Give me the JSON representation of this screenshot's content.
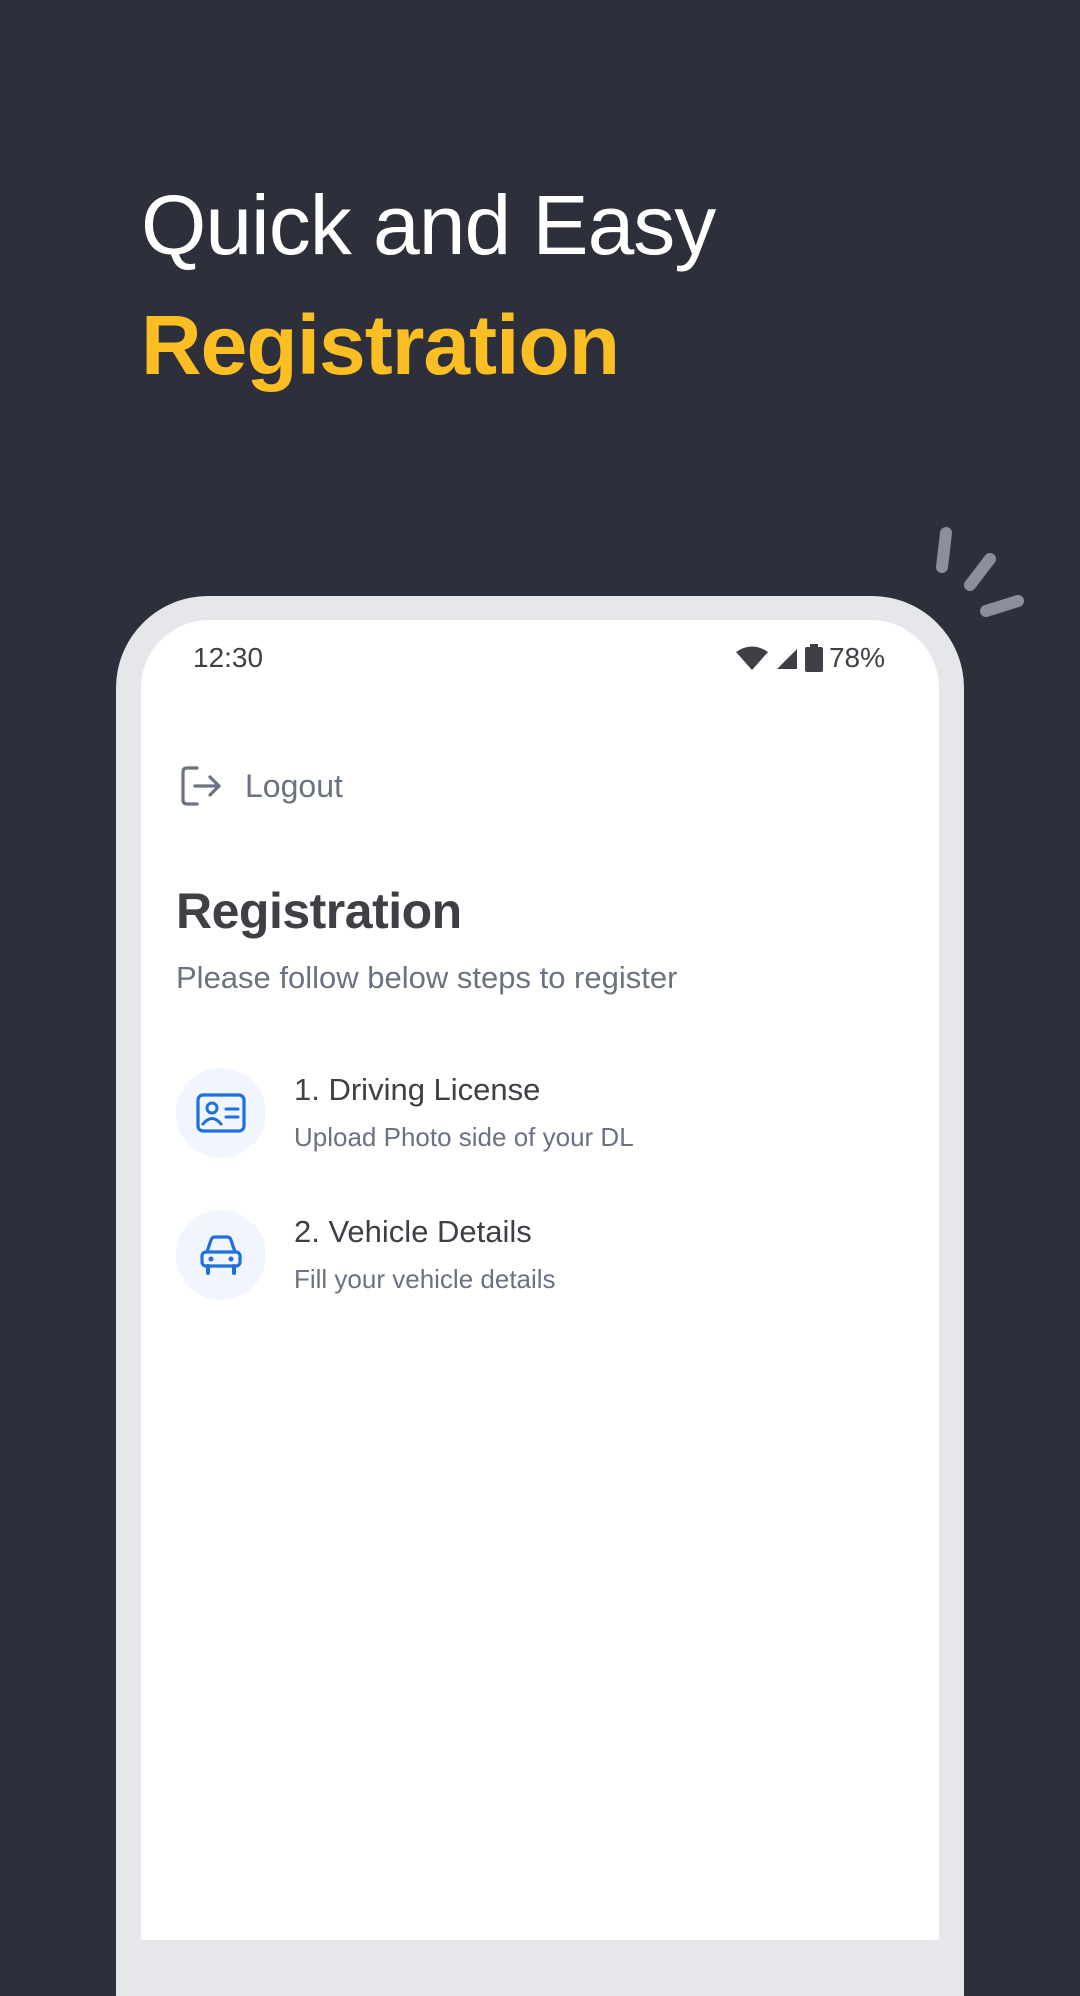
{
  "hero": {
    "line1": "Quick and Easy",
    "line2": "Registration",
    "accent_color": "#fbbf24",
    "background_color": "#2d2f3a"
  },
  "status_bar": {
    "time": "12:30",
    "battery": "78%",
    "icons": [
      "wifi-icon",
      "signal-icon",
      "battery-icon"
    ]
  },
  "logout": {
    "label": "Logout",
    "icon": "logout-icon"
  },
  "registration": {
    "title": "Registration",
    "subtitle": "Please follow below steps to register"
  },
  "steps": [
    {
      "title": "1. Driving License",
      "description": "Upload Photo side of your DL",
      "icon": "id-card-icon"
    },
    {
      "title": "2. Vehicle Details",
      "description": "Fill your vehicle details",
      "icon": "car-icon"
    }
  ],
  "colors": {
    "icon_blue": "#1f6fe0",
    "icon_bg": "#f1f5fd",
    "phone_frame": "#e5e7eb"
  }
}
